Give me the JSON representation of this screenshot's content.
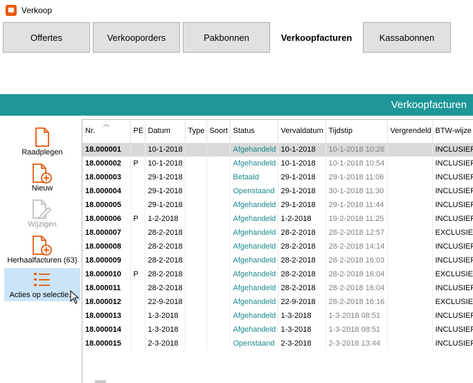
{
  "window": {
    "title": "Verkoop"
  },
  "tabs": [
    {
      "label": "Offertes"
    },
    {
      "label": "Verkooporders"
    },
    {
      "label": "Pakbonnen"
    },
    {
      "label": "Verkoopfacturen"
    },
    {
      "label": "Kassabonnen"
    }
  ],
  "header": {
    "title": "Verkoopfacturen"
  },
  "sidebar": {
    "items": [
      {
        "label": "Raadplegen",
        "icon": "document-icon"
      },
      {
        "label": "Nieuw",
        "icon": "document-add-icon"
      },
      {
        "label": "Wijzigen",
        "icon": "document-edit-icon"
      },
      {
        "label": "Herhaalfacturen (63)",
        "icon": "document-repeat-icon"
      },
      {
        "label": "Acties op selectie...",
        "icon": "list-actions-icon"
      }
    ]
  },
  "colors": {
    "accent": "#1e9698",
    "icon_orange": "#e8590c",
    "status_text": "#1a8a8c",
    "selected_row": "#d9d9d9"
  },
  "table": {
    "columns": [
      "Nr.",
      "PE",
      "Datum",
      "Type",
      "Soort",
      "Status",
      "Vervaldatum",
      "Tijdstip",
      "Vergrendeld",
      "BTW-wijze"
    ],
    "rows": [
      {
        "nr": "18.000001",
        "pe": "",
        "datum": "10-1-2018",
        "type": "",
        "soort": "",
        "status": "Afgehandeld",
        "vervaldatum": "10-1-2018",
        "tijdstip": "10-1-2018 10:26",
        "vergrendeld": "",
        "btw": "INCLUSIEF"
      },
      {
        "nr": "18.000002",
        "pe": "P",
        "datum": "10-1-2018",
        "type": "",
        "soort": "",
        "status": "Afgehandeld",
        "vervaldatum": "10-1-2018",
        "tijdstip": "10-1-2018 10:54",
        "vergrendeld": "",
        "btw": "INCLUSIEF"
      },
      {
        "nr": "18.000003",
        "pe": "",
        "datum": "29-1-2018",
        "type": "",
        "soort": "",
        "status": "Betaald",
        "vervaldatum": "29-1-2018",
        "tijdstip": "29-1-2018 11:06",
        "vergrendeld": "",
        "btw": "INCLUSIEF"
      },
      {
        "nr": "18.000004",
        "pe": "",
        "datum": "29-1-2018",
        "type": "",
        "soort": "",
        "status": "Openstaand",
        "vervaldatum": "29-1-2018",
        "tijdstip": "30-1-2018 11:30",
        "vergrendeld": "",
        "btw": "INCLUSIEF"
      },
      {
        "nr": "18.000005",
        "pe": "",
        "datum": "29-1-2018",
        "type": "",
        "soort": "",
        "status": "Afgehandeld",
        "vervaldatum": "29-1-2018",
        "tijdstip": "29-1-2018 11:44",
        "vergrendeld": "",
        "btw": "INCLUSIEF"
      },
      {
        "nr": "18.000006",
        "pe": "P",
        "datum": "1-2-2018",
        "type": "",
        "soort": "",
        "status": "Afgehandeld",
        "vervaldatum": "1-2-2018",
        "tijdstip": "19-2-2018 11:25",
        "vergrendeld": "",
        "btw": "INCLUSIEF"
      },
      {
        "nr": "18.000007",
        "pe": "",
        "datum": "28-2-2018",
        "type": "",
        "soort": "",
        "status": "Afgehandeld",
        "vervaldatum": "28-2-2018",
        "tijdstip": "28-2-2018 12:57",
        "vergrendeld": "",
        "btw": "EXCLUSIEF"
      },
      {
        "nr": "18.000008",
        "pe": "",
        "datum": "28-2-2018",
        "type": "",
        "soort": "",
        "status": "Afgehandeld",
        "vervaldatum": "28-2-2018",
        "tijdstip": "28-2-2018 14:14",
        "vergrendeld": "",
        "btw": "INCLUSIEF"
      },
      {
        "nr": "18.000009",
        "pe": "",
        "datum": "28-2-2018",
        "type": "",
        "soort": "",
        "status": "Afgehandeld",
        "vervaldatum": "28-2-2018",
        "tijdstip": "28-2-2018 16:03",
        "vergrendeld": "",
        "btw": "INCLUSIEF"
      },
      {
        "nr": "18.000010",
        "pe": "P",
        "datum": "28-2-2018",
        "type": "",
        "soort": "",
        "status": "Afgehandeld",
        "vervaldatum": "28-2-2018",
        "tijdstip": "28-2-2018 16:04",
        "vergrendeld": "",
        "btw": "EXCLUSIEF"
      },
      {
        "nr": "18.000011",
        "pe": "",
        "datum": "28-2-2018",
        "type": "",
        "soort": "",
        "status": "Afgehandeld",
        "vervaldatum": "28-2-2018",
        "tijdstip": "28-2-2018 16:04",
        "vergrendeld": "",
        "btw": "INCLUSIEF"
      },
      {
        "nr": "18.000012",
        "pe": "",
        "datum": "22-9-2018",
        "type": "",
        "soort": "",
        "status": "Afgehandeld",
        "vervaldatum": "22-9-2018",
        "tijdstip": "28-2-2018 16:16",
        "vergrendeld": "",
        "btw": "EXCLUSIEF"
      },
      {
        "nr": "18.000013",
        "pe": "",
        "datum": "1-3-2018",
        "type": "",
        "soort": "",
        "status": "Afgehandeld",
        "vervaldatum": "1-3-2018",
        "tijdstip": "1-3-2018 08:51",
        "vergrendeld": "",
        "btw": "INCLUSIEF"
      },
      {
        "nr": "18.000014",
        "pe": "",
        "datum": "1-3-2018",
        "type": "",
        "soort": "",
        "status": "Afgehandeld",
        "vervaldatum": "1-3-2018",
        "tijdstip": "1-3-2018 08:51",
        "vergrendeld": "",
        "btw": "INCLUSIEF"
      },
      {
        "nr": "18.000015",
        "pe": "",
        "datum": "2-3-2018",
        "type": "",
        "soort": "",
        "status": "Openstaand",
        "vervaldatum": "2-3-2018",
        "tijdstip": "2-3-2018 13:44",
        "vergrendeld": "",
        "btw": "INCLUSIEF"
      }
    ]
  }
}
